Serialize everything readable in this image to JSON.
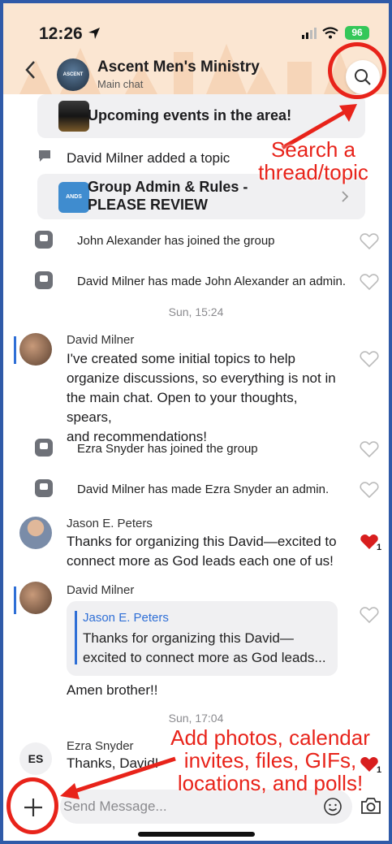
{
  "status_bar": {
    "time": "12:26",
    "battery": "96"
  },
  "header": {
    "title": "Ascent Men's Ministry",
    "subtitle": "Main chat",
    "avatar_text": "ASCENT"
  },
  "topics": [
    {
      "title": "Upcoming events in the area!"
    },
    {
      "title_line1": "Group Admin & Rules -",
      "title_line2": "PLEASE REVIEW",
      "thumb_text": "ANDS"
    }
  ],
  "topic_added": "David Milner added a topic",
  "system_messages": [
    "John Alexander has joined the group",
    "David Milner has made John Alexander an admin.",
    "Ezra Snyder has joined the group",
    "David Milner has made Ezra Snyder an admin."
  ],
  "time_dividers": [
    "Sun, 15:24",
    "Sun, 17:04"
  ],
  "messages": [
    {
      "author": "David Milner",
      "lines": [
        "I've created some initial topics to help",
        "organize discussions, so everything is not in",
        "the main chat. Open to your thoughts, spears,",
        "and recommendations!"
      ]
    },
    {
      "author": "Jason E. Peters",
      "lines": [
        "Thanks for organizing this David—excited to",
        "connect more as God leads each one of us!"
      ],
      "likes": "1"
    },
    {
      "author": "David Milner",
      "quote_author": "Jason E. Peters",
      "quote_lines": [
        "Thanks for organizing this David—",
        "excited to connect more as God leads..."
      ],
      "text": "Amen brother!!"
    },
    {
      "author": "Ezra Snyder",
      "initials": "ES",
      "text": "Thanks, David!",
      "likes": "1"
    }
  ],
  "composer": {
    "placeholder": "Send Message..."
  },
  "annotations": {
    "search": [
      "Search a",
      "thread/topic"
    ],
    "add": [
      "Add photos, calendar",
      "invites, files, GIFs,",
      "locations, and polls!"
    ]
  },
  "colors": {
    "accent_red": "#e8231a",
    "link_blue": "#2f6fd6",
    "header_bg": "#fbe6d2",
    "frame_blue": "#2f5aa8"
  },
  "icons": [
    "location-arrow-icon",
    "signal-icon",
    "wifi-icon",
    "back-chevron-icon",
    "search-icon",
    "chat-bubble-icon",
    "system-message-icon",
    "heart-icon",
    "plus-icon",
    "emoji-icon",
    "camera-icon"
  ]
}
